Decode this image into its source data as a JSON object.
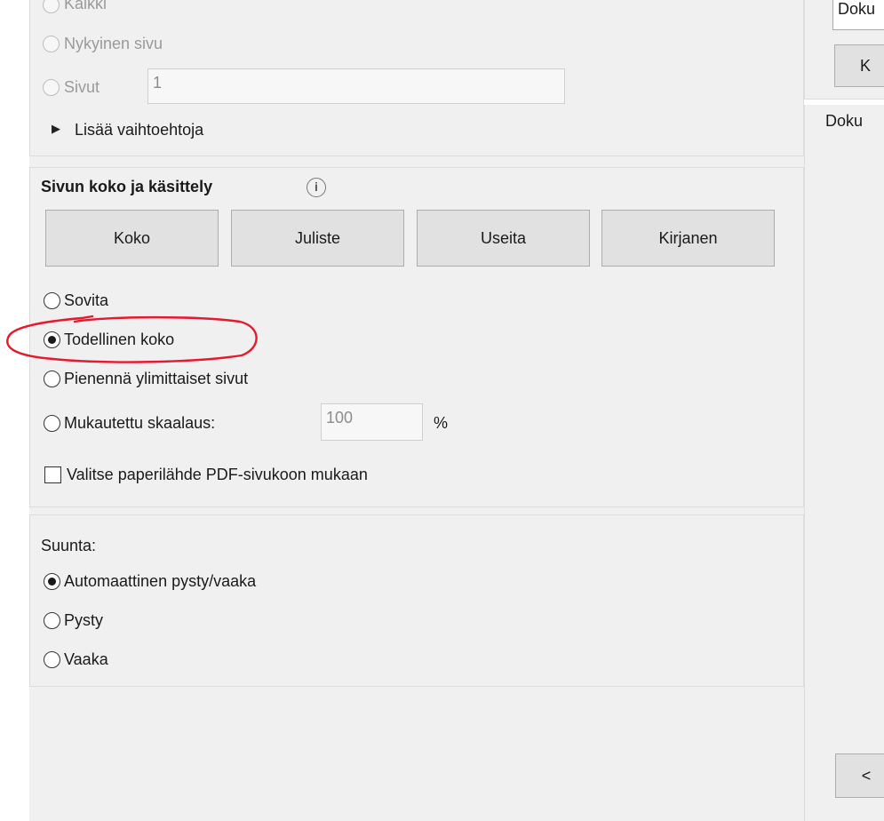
{
  "page_range": {
    "option_all_label": "Kaikki",
    "option_current_label": "Nykyinen sivu",
    "option_pages_label": "Sivut",
    "pages_value": "1",
    "more_options_label": "Lisää vaihtoehtoja"
  },
  "page_size": {
    "title": "Sivun koko ja käsittely",
    "tabs": [
      "Koko",
      "Juliste",
      "Useita",
      "Kirjanen"
    ],
    "option_fit_label": "Sovita",
    "option_actual_label": "Todellinen koko",
    "option_shrink_label": "Pienennä ylimittaiset sivut",
    "option_custom_label": "Mukautettu skaalaus:",
    "custom_value": "100",
    "percent_label": "%",
    "paper_source_label": "Valitse paperilähde PDF-sivukoon mukaan",
    "selected": "Todellinen koko"
  },
  "orientation": {
    "title": "Suunta:",
    "option_auto_label": "Automaattinen pysty/vaaka",
    "option_portrait_label": "Pysty",
    "option_landscape_label": "Vaaka",
    "selected": "Automaattinen pysty/vaaka"
  },
  "right_panel": {
    "dropdown_value": "Doku",
    "button_label": "K",
    "section_label": "Doku",
    "prev_button_label": "<"
  },
  "colors": {
    "annotation": "#e8192c",
    "panel_bg": "#f0f0f0",
    "button_bg": "#e1e1e1"
  }
}
